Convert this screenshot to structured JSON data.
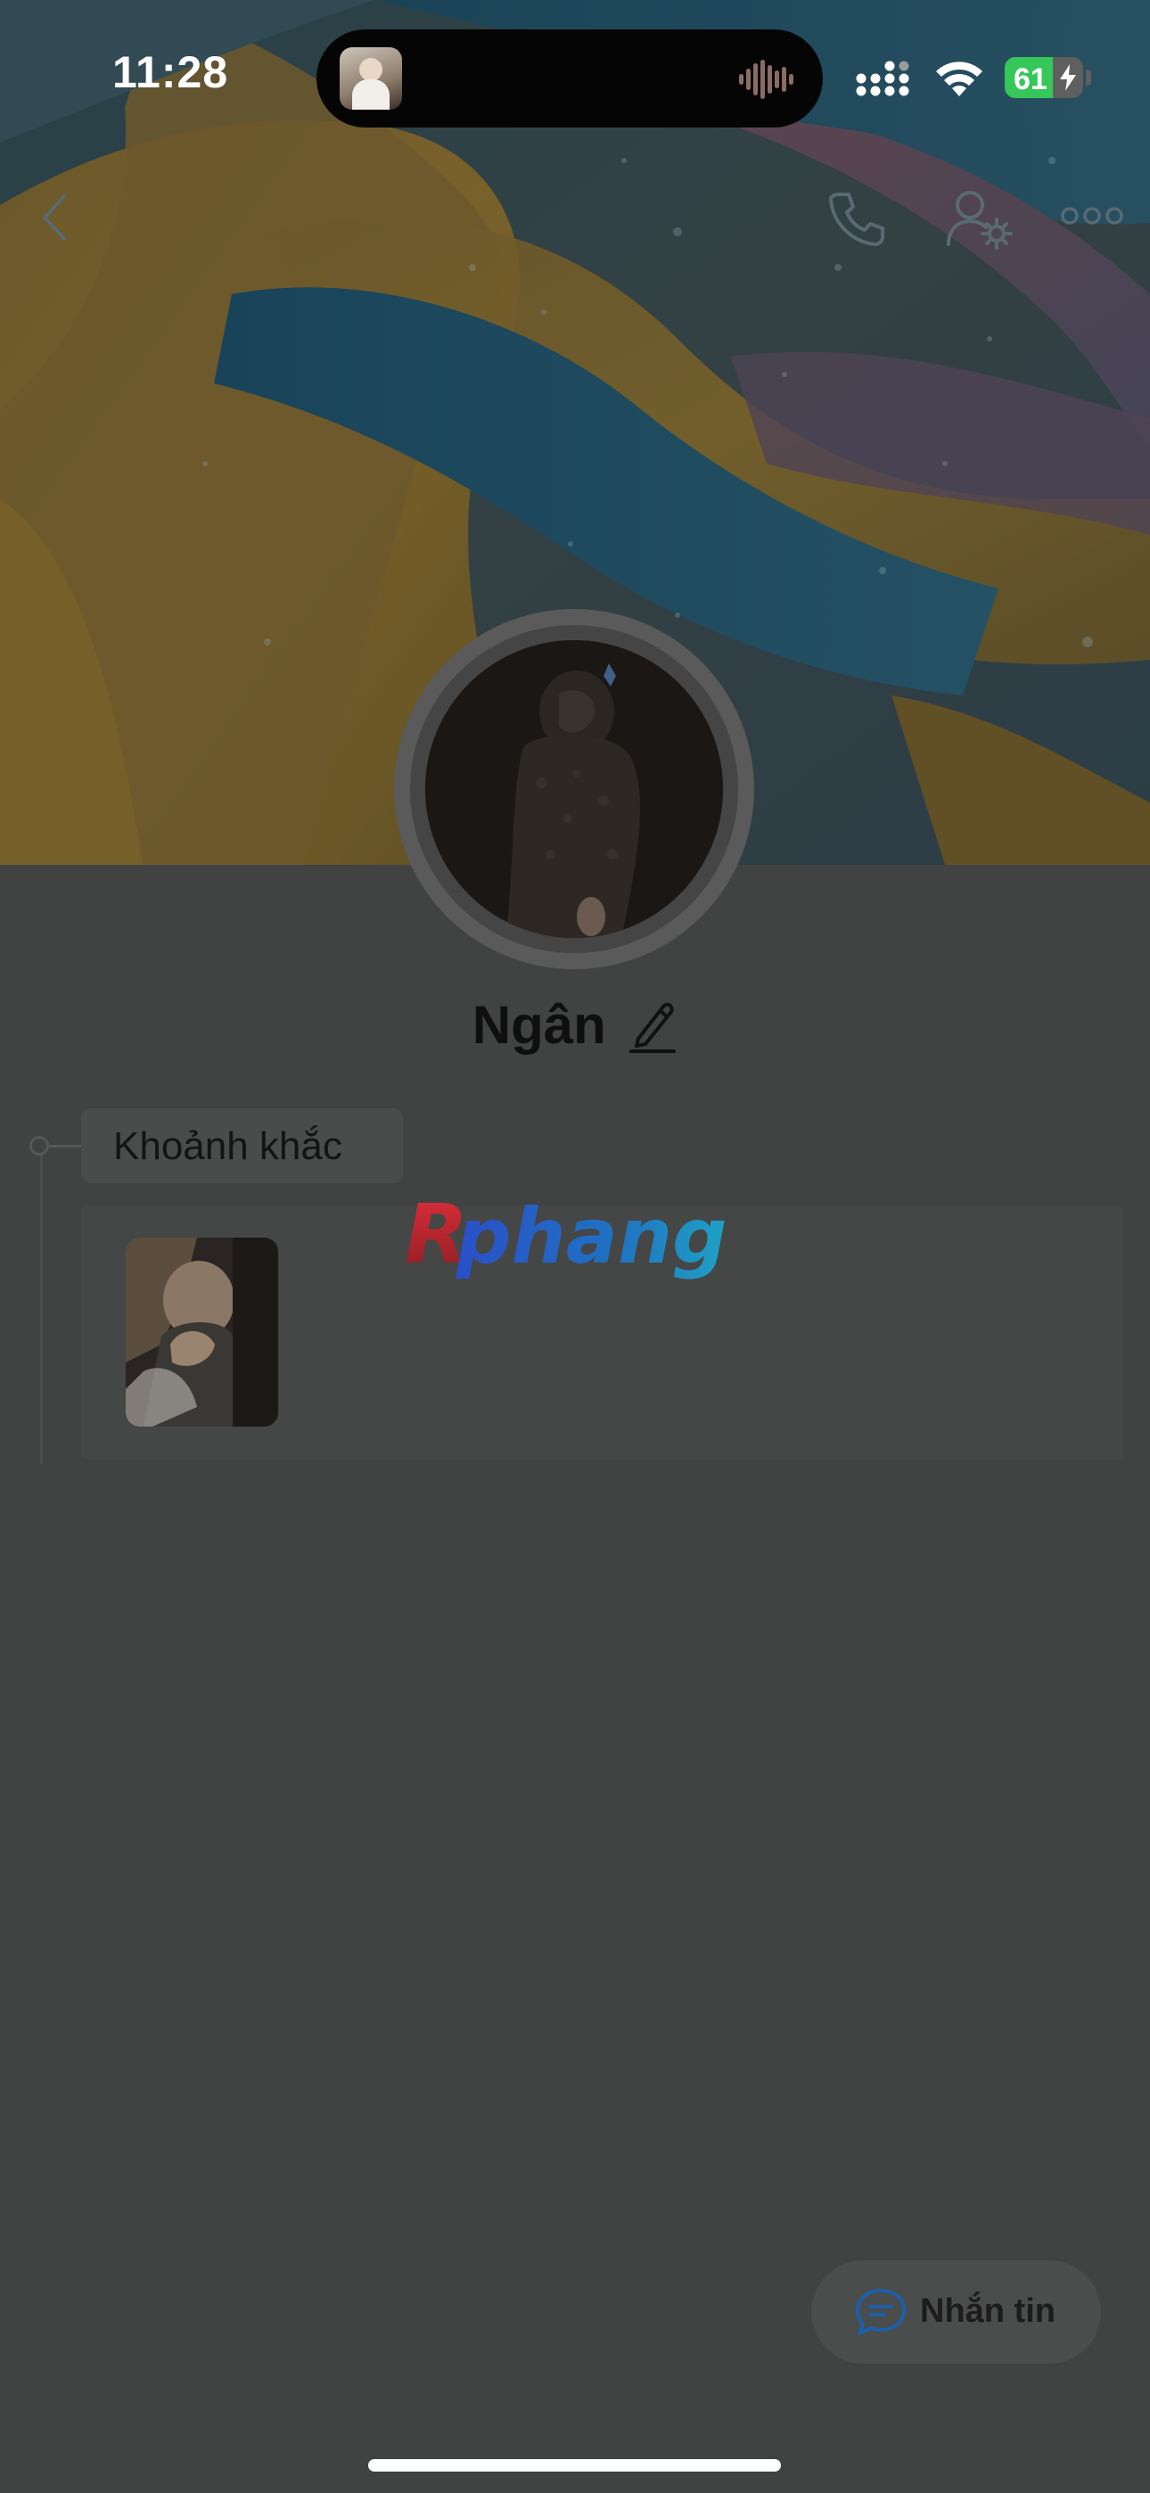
{
  "status_bar": {
    "time": "11:28",
    "battery_level": "61",
    "battery_fraction": 0.61,
    "battery_color": "#35c759",
    "icons": [
      "signal-icon",
      "wifi-icon",
      "battery-icon",
      "charging-bolt-icon",
      "audio-wave-icon"
    ]
  },
  "header": {
    "icons": [
      "back-icon",
      "call-icon",
      "profile-settings-icon",
      "more-icon"
    ]
  },
  "profile": {
    "name": "Ngân",
    "edit_icon": "pencil-icon"
  },
  "moments": {
    "label": "Khoảnh khắc"
  },
  "watermark": {
    "text": "Rphang"
  },
  "actions": {
    "message_label": "Nhắn tin",
    "message_icon": "chat-bubble-icon"
  },
  "colors": {
    "overlay_background": "#414242",
    "accent_blue": "#1d5fa8"
  }
}
